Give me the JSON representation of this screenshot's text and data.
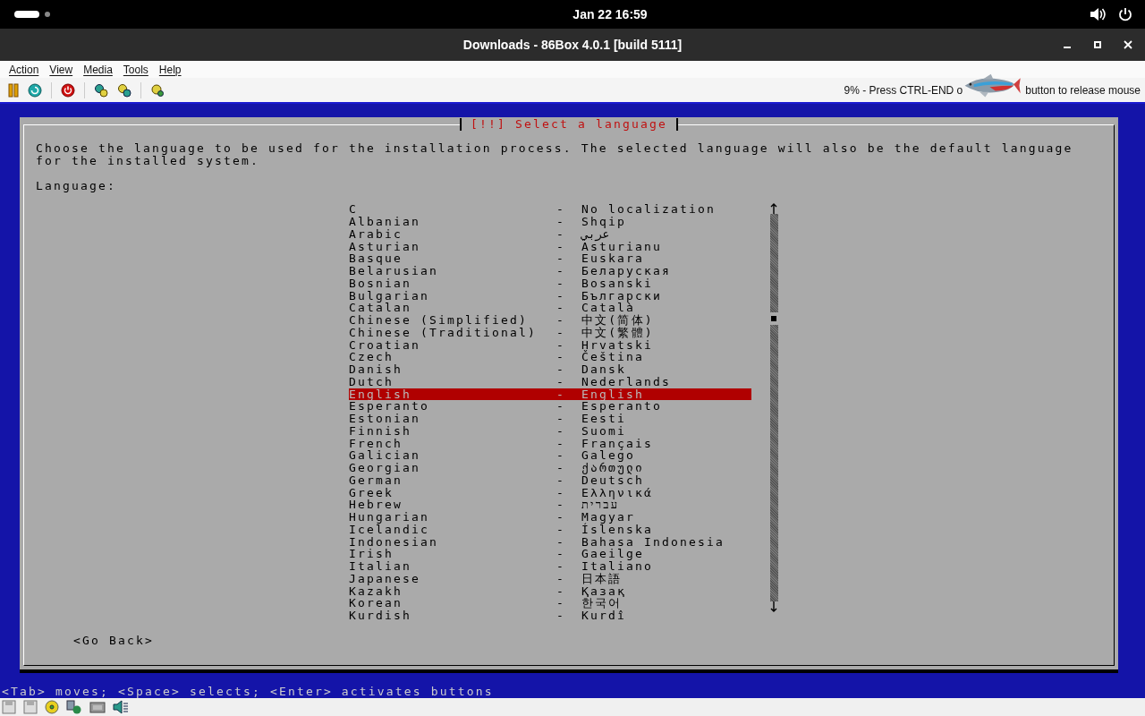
{
  "top_bar": {
    "clock": "Jan 22  16:59"
  },
  "window": {
    "title": "Downloads - 86Box 4.0.1 [build 5111]"
  },
  "menu": [
    "Action",
    "View",
    "Media",
    "Tools",
    "Help"
  ],
  "toolbar_status": [
    "9% - Press CTRL-END o",
    "button to release mouse"
  ],
  "dialog": {
    "title": "[!!] Select a language",
    "prompt": "Choose the language to be used for the installation process. The selected language will also be the default language for the installed system.",
    "label": "Language:",
    "languages": [
      {
        "name": "C",
        "dash": "-",
        "native": "No localization",
        "selected": false
      },
      {
        "name": "Albanian",
        "dash": "-",
        "native": "Shqip",
        "selected": false
      },
      {
        "name": "Arabic",
        "dash": "-",
        "native": "عربي",
        "selected": false
      },
      {
        "name": "Asturian",
        "dash": "-",
        "native": "Asturianu",
        "selected": false
      },
      {
        "name": "Basque",
        "dash": "-",
        "native": "Euskara",
        "selected": false
      },
      {
        "name": "Belarusian",
        "dash": "-",
        "native": "Беларуская",
        "selected": false
      },
      {
        "name": "Bosnian",
        "dash": "-",
        "native": "Bosanski",
        "selected": false
      },
      {
        "name": "Bulgarian",
        "dash": "-",
        "native": "Български",
        "selected": false
      },
      {
        "name": "Catalan",
        "dash": "-",
        "native": "Català",
        "selected": false
      },
      {
        "name": "Chinese (Simplified)",
        "dash": "-",
        "native": "中文(简体)",
        "selected": false
      },
      {
        "name": "Chinese (Traditional)",
        "dash": "-",
        "native": "中文(繁體)",
        "selected": false
      },
      {
        "name": "Croatian",
        "dash": "-",
        "native": "Hrvatski",
        "selected": false
      },
      {
        "name": "Czech",
        "dash": "-",
        "native": "Čeština",
        "selected": false
      },
      {
        "name": "Danish",
        "dash": "-",
        "native": "Dansk",
        "selected": false
      },
      {
        "name": "Dutch",
        "dash": "-",
        "native": "Nederlands",
        "selected": false
      },
      {
        "name": "English",
        "dash": "-",
        "native": "English",
        "selected": true
      },
      {
        "name": "Esperanto",
        "dash": "-",
        "native": "Esperanto",
        "selected": false
      },
      {
        "name": "Estonian",
        "dash": "-",
        "native": "Eesti",
        "selected": false
      },
      {
        "name": "Finnish",
        "dash": "-",
        "native": "Suomi",
        "selected": false
      },
      {
        "name": "French",
        "dash": "-",
        "native": "Français",
        "selected": false
      },
      {
        "name": "Galician",
        "dash": "-",
        "native": "Galego",
        "selected": false
      },
      {
        "name": "Georgian",
        "dash": "-",
        "native": "ქართული",
        "selected": false
      },
      {
        "name": "German",
        "dash": "-",
        "native": "Deutsch",
        "selected": false
      },
      {
        "name": "Greek",
        "dash": "-",
        "native": "Ελληνικά",
        "selected": false
      },
      {
        "name": "Hebrew",
        "dash": "-",
        "native": "עברית",
        "selected": false
      },
      {
        "name": "Hungarian",
        "dash": "-",
        "native": "Magyar",
        "selected": false
      },
      {
        "name": "Icelandic",
        "dash": "-",
        "native": "Íslenska",
        "selected": false
      },
      {
        "name": "Indonesian",
        "dash": "-",
        "native": "Bahasa Indonesia",
        "selected": false
      },
      {
        "name": "Irish",
        "dash": "-",
        "native": "Gaeilge",
        "selected": false
      },
      {
        "name": "Italian",
        "dash": "-",
        "native": "Italiano",
        "selected": false
      },
      {
        "name": "Japanese",
        "dash": "-",
        "native": "日本語",
        "selected": false
      },
      {
        "name": "Kazakh",
        "dash": "-",
        "native": "Қазақ",
        "selected": false
      },
      {
        "name": "Korean",
        "dash": "-",
        "native": "한국어",
        "selected": false
      },
      {
        "name": "Kurdish",
        "dash": "-",
        "native": "Kurdî",
        "selected": false
      }
    ],
    "back_button": "<Go Back>"
  },
  "help_line": "<Tab> moves; <Space> selects; <Enter> activates buttons"
}
